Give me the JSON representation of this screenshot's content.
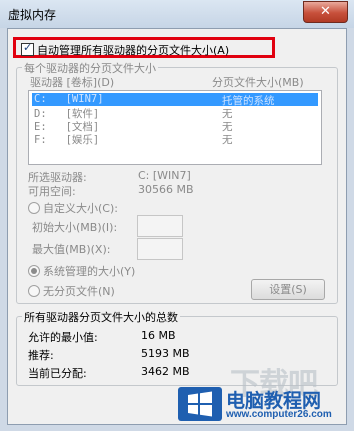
{
  "window": {
    "title": "虚拟内存",
    "close_glyph": "✕"
  },
  "auto_manage": {
    "label": "自动管理所有驱动器的分页文件大小(A)",
    "checked": true
  },
  "per_drive_group": {
    "legend": "每个驱动器的分页文件大小",
    "col_drive": "驱动器 [卷标](D)",
    "col_pagefile": "分页文件大小(MB)",
    "rows": [
      {
        "drive": "C:   [WIN7]",
        "pagefile": "托管的系统"
      },
      {
        "drive": "D:   [软件]",
        "pagefile": "无"
      },
      {
        "drive": "E:   [文档]",
        "pagefile": "无"
      },
      {
        "drive": "F:   [娱乐]",
        "pagefile": "无"
      }
    ],
    "selected_drive_label": "所选驱动器:",
    "selected_drive_value": "C:  [WIN7]",
    "free_space_label": "可用空间:",
    "free_space_value": "30566 MB",
    "custom_size_label": "自定义大小(C):",
    "initial_size_label": "初始大小(MB)(I):",
    "max_size_label": "最大值(MB)(X):",
    "system_managed_label": "系统管理的大小(Y)",
    "no_paging_label": "无分页文件(N)",
    "set_button": "设置(S)"
  },
  "totals_group": {
    "legend": "所有驱动器分页文件大小的总数",
    "min_label": "允许的最小值:",
    "min_value": "16 MB",
    "recommended_label": "推荐:",
    "recommended_value": "5193 MB",
    "current_label": "当前已分配:",
    "current_value": "3462 MB"
  },
  "watermark": {
    "brand": "电脑教程网",
    "url": "www.computer26.com",
    "faded_text": "下载吧"
  },
  "colors": {
    "highlight_border": "#e1000f",
    "selection": "#3399ff",
    "watermark_blue": "#1f5fb0"
  }
}
